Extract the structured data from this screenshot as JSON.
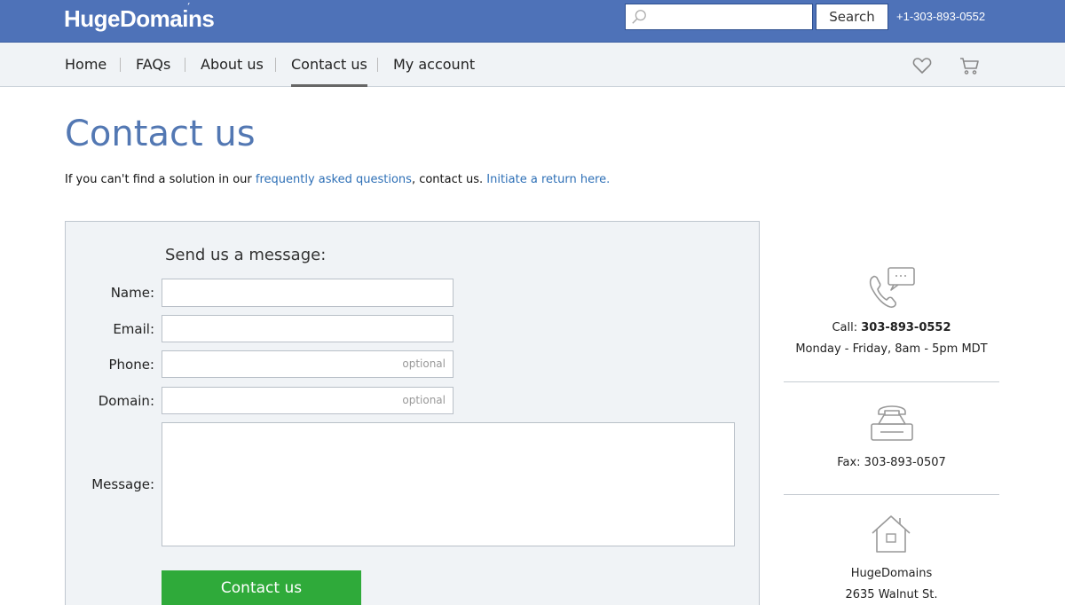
{
  "header": {
    "logo": "HugeDomains",
    "search_placeholder": "",
    "search_button": "Search",
    "phone": "+1-303-893-0552"
  },
  "nav": {
    "items": [
      {
        "label": "Home"
      },
      {
        "label": "FAQs"
      },
      {
        "label": "About us"
      },
      {
        "label": "Contact us",
        "active": true
      },
      {
        "label": "My account"
      }
    ],
    "icons": [
      "heart-icon",
      "cart-icon"
    ]
  },
  "page": {
    "title": "Contact us",
    "intro_text_1": "If you can't find a solution in our ",
    "intro_link_faq": "frequently asked questions",
    "intro_text_2": ", contact us. ",
    "intro_link_return": "Initiate a return here."
  },
  "form": {
    "heading": "Send us a message:",
    "name_label": "Name:",
    "email_label": "Email:",
    "phone_label": "Phone:",
    "phone_placeholder": "optional",
    "domain_label": "Domain:",
    "domain_placeholder": "optional",
    "message_label": "Message:",
    "submit_label": "Contact us"
  },
  "contact_info": {
    "call_prefix": "Call: ",
    "call_number": "303-893-0552",
    "hours": "Monday - Friday, 8am - 5pm MDT",
    "fax": "Fax: 303-893-0507",
    "company": "HugeDomains",
    "address_line1": "2635 Walnut St."
  },
  "colors": {
    "header_bg": "#4e72b8",
    "title": "#5378b3",
    "link": "#2d6fb6",
    "button_green": "#2faa3a"
  }
}
